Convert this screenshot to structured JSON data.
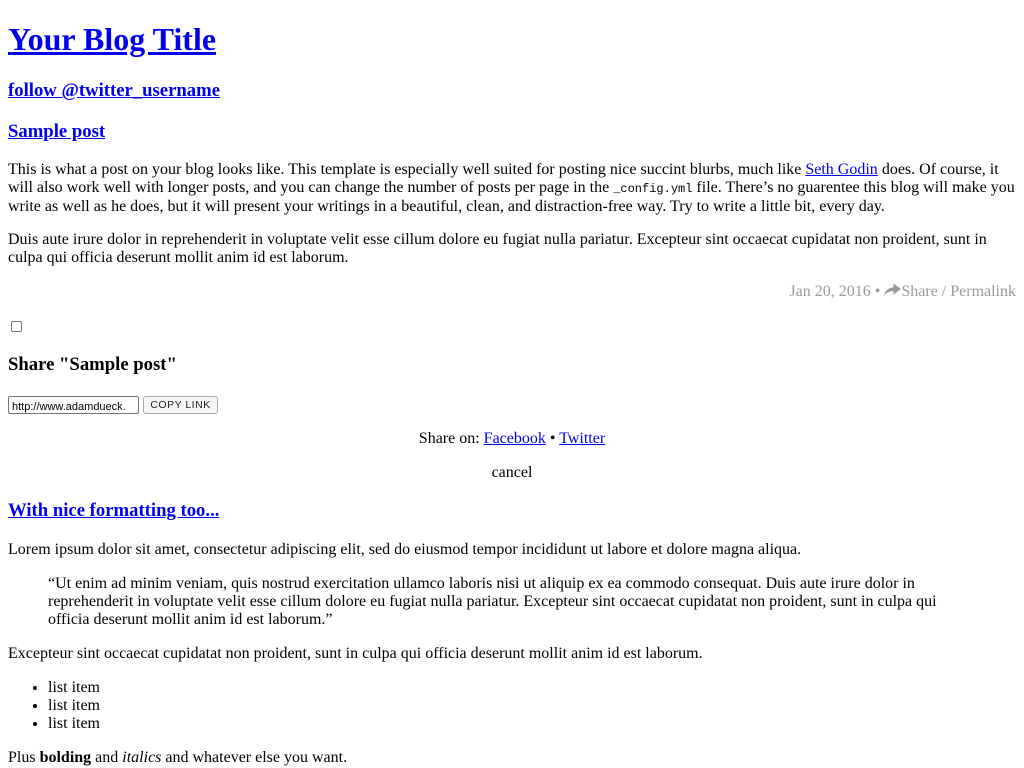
{
  "blog": {
    "title": "Your Blog Title",
    "follow": "follow @twitter_username"
  },
  "posts": [
    {
      "title": "Sample post",
      "paragraphs": {
        "p1_before_link": "This is what a post on your blog looks like. This template is especially well suited for posting nice succint blurbs, much like ",
        "p1_link": "Seth Godin",
        "p1_after_link": " does. Of course, it will also work well with longer posts, and you can change the number of posts per page in the ",
        "p1_code": "_config.yml",
        "p1_end": " file. There’s no guarentee this blog will make you write as well as he does, but it will present your writings in a beautiful, clean, and distraction-free way. Try to write a little bit, every day.",
        "p2": "Duis aute irure dolor in reprehenderit in voluptate velit esse cillum dolore eu fugiat nulla pariatur. Excepteur sint occaecat cupidatat non proident, sunt in culpa qui officia deserunt mollit anim id est laborum."
      },
      "meta": {
        "date": "Jan 20, 2016",
        "separator": "•",
        "share_label": "Share",
        "slash": "/",
        "permalink": "Permalink"
      }
    },
    {
      "title": "With nice formatting too...",
      "intro": "Lorem ipsum dolor sit amet, consectetur adipiscing elit, sed do eiusmod tempor incididunt ut labore et dolore magna aliqua.",
      "quote": "“Ut enim ad minim veniam, quis nostrud exercitation ullamco laboris nisi ut aliquip ex ea commodo consequat. Duis aute irure dolor in reprehenderit in voluptate velit esse cillum dolore eu fugiat nulla pariatur. Excepteur sint occaecat cupidatat non proident, sunt in culpa qui officia deserunt mollit anim id est laborum.”",
      "after_quote": "Excepteur sint occaecat cupidatat non proident, sunt in culpa qui officia deserunt mollit anim id est laborum.",
      "list": [
        "list item",
        "list item",
        "list item"
      ],
      "closing": {
        "before": "Plus ",
        "bold": "bolding",
        "middle": " and ",
        "italic": "italics",
        "after": " and whatever else you want."
      }
    }
  ],
  "share_panel": {
    "checked": false,
    "heading": "Share \"Sample post\"",
    "url_value": "http://www.adamdueck.",
    "copy_label": "COPY LINK",
    "share_on": "Share on:",
    "facebook": "Facebook",
    "dot": "•",
    "twitter": "Twitter",
    "cancel": "cancel"
  },
  "colors": {
    "link": "#0000ee",
    "meta": "#999999"
  },
  "icons": {
    "share": "share-arrow-icon"
  }
}
